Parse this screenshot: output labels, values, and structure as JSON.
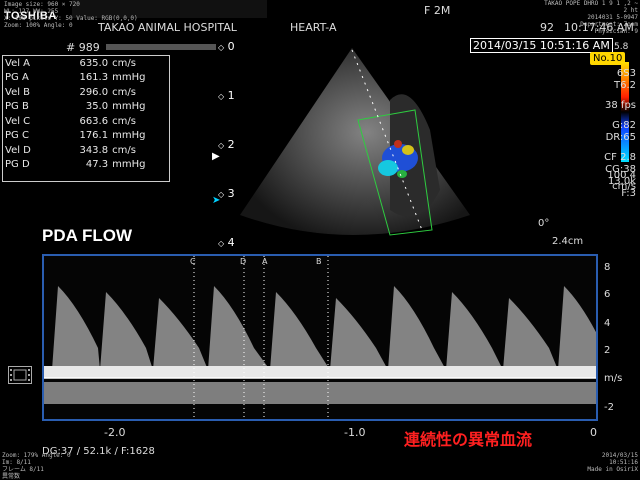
{
  "header": {
    "brand": "TOSHIBA",
    "meta_lines": [
      "Image size: 960 × 720",
      "WL: 127 WW: 255",
      "X: 198 pixels  Y: 50 Value: RGB(0,0,0)",
      "Zoom: 100%  Angle: 0"
    ],
    "hospital": "TAKAO ANIMAL HOSPITAL",
    "probe": "HEART-A",
    "frequency": "F  2M",
    "index": "92",
    "time": "10:17:46 AM",
    "top_right_lines": [
      "TAKAO POPE DHRO 1 9 1 ,2 ~  2 ht",
      "2014031 5-0947",
      "Department: Zoom",
      "Physician: 9"
    ],
    "patient_id": "# 989",
    "date": "2014/03/15 10:51:16 AM",
    "no_badge": "No.10"
  },
  "measurements": [
    {
      "label": "Vel  A",
      "value": "635.0",
      "unit": "cm/s"
    },
    {
      "label": "PG  A",
      "value": "161.3",
      "unit": "mmHg"
    },
    {
      "label": "Vel  B",
      "value": "296.0",
      "unit": "cm/s"
    },
    {
      "label": "PG  B",
      "value": "35.0",
      "unit": "mmHg"
    },
    {
      "label": "Vel  C",
      "value": "663.6",
      "unit": "cm/s"
    },
    {
      "label": "PG  C",
      "value": "176.1",
      "unit": "mmHg"
    },
    {
      "label": "Vel  D",
      "value": "343.8",
      "unit": "cm/s"
    },
    {
      "label": "PG  D",
      "value": "47.3",
      "unit": "mmHg"
    }
  ],
  "params": {
    "probe_setting": "6S3",
    "t": "T6.2",
    "fps": "38 fps",
    "gain": "G:82",
    "dr": "DR:65",
    "cf": "CF 2.8",
    "cg": "CG:38",
    "khz": "13.0k",
    "f": "F:3",
    "angle": "0°",
    "depth": "2.4cm",
    "scale_top": "5.8",
    "scale_value": "100.4",
    "scale_unit": "cm/s"
  },
  "depth_ticks": [
    "0",
    "1",
    "2",
    "3",
    "4"
  ],
  "title": "PDA FLOW",
  "doppler": {
    "y_ticks": [
      "8",
      "6",
      "4",
      "2",
      "m/s",
      "-2"
    ],
    "x_ticks": [
      "-2.0",
      "-1.0",
      "0"
    ],
    "markers": [
      "C",
      "D",
      "A",
      "B"
    ],
    "status": "DG:37  / 52.1k  / F:1628"
  },
  "annotation_jp": "連続性の異常血流",
  "footer": {
    "bl_lines": [
      "Zoom: 179% Angle: 0",
      "Im: 8/11",
      "フレーム 8/11",
      "異常数"
    ],
    "br_lines": [
      "2014/03/15 10:51:16",
      "Made in OsiriX"
    ]
  },
  "colors": {
    "doppler_border": "#2a5db0",
    "badge": "#ffd700",
    "jp_text": "#ff2020",
    "green_roi": "#2ecc40"
  }
}
